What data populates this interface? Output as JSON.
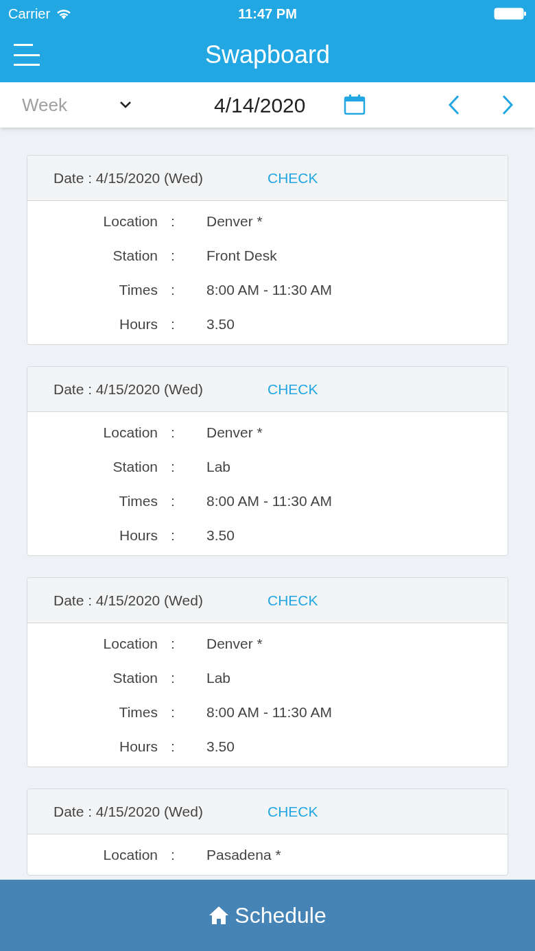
{
  "status_bar": {
    "carrier": "Carrier",
    "time": "11:47 PM"
  },
  "nav": {
    "title": "Swapboard"
  },
  "toolbar": {
    "period": "Week",
    "date": "4/14/2020"
  },
  "cards": [
    {
      "date": "Date : 4/15/2020 (Wed)",
      "action": "CHECK",
      "rows": [
        {
          "label": "Location",
          "sep": ":",
          "value": "Denver *"
        },
        {
          "label": "Station",
          "sep": ":",
          "value": "Front Desk"
        },
        {
          "label": "Times",
          "sep": ":",
          "value": "8:00 AM - 11:30 AM"
        },
        {
          "label": "Hours",
          "sep": ":",
          "value": "3.50"
        }
      ]
    },
    {
      "date": "Date : 4/15/2020 (Wed)",
      "action": "CHECK",
      "rows": [
        {
          "label": "Location",
          "sep": ":",
          "value": "Denver *"
        },
        {
          "label": "Station",
          "sep": ":",
          "value": "Lab"
        },
        {
          "label": "Times",
          "sep": ":",
          "value": "8:00 AM - 11:30 AM"
        },
        {
          "label": "Hours",
          "sep": ":",
          "value": "3.50"
        }
      ]
    },
    {
      "date": "Date : 4/15/2020 (Wed)",
      "action": "CHECK",
      "rows": [
        {
          "label": "Location",
          "sep": ":",
          "value": "Denver *"
        },
        {
          "label": "Station",
          "sep": ":",
          "value": "Lab"
        },
        {
          "label": "Times",
          "sep": ":",
          "value": "8:00 AM - 11:30 AM"
        },
        {
          "label": "Hours",
          "sep": ":",
          "value": "3.50"
        }
      ]
    },
    {
      "date": "Date : 4/15/2020 (Wed)",
      "action": "CHECK",
      "rows": [
        {
          "label": "Location",
          "sep": ":",
          "value": "Pasadena *"
        }
      ]
    }
  ],
  "bottom_bar": {
    "label": "Schedule"
  }
}
